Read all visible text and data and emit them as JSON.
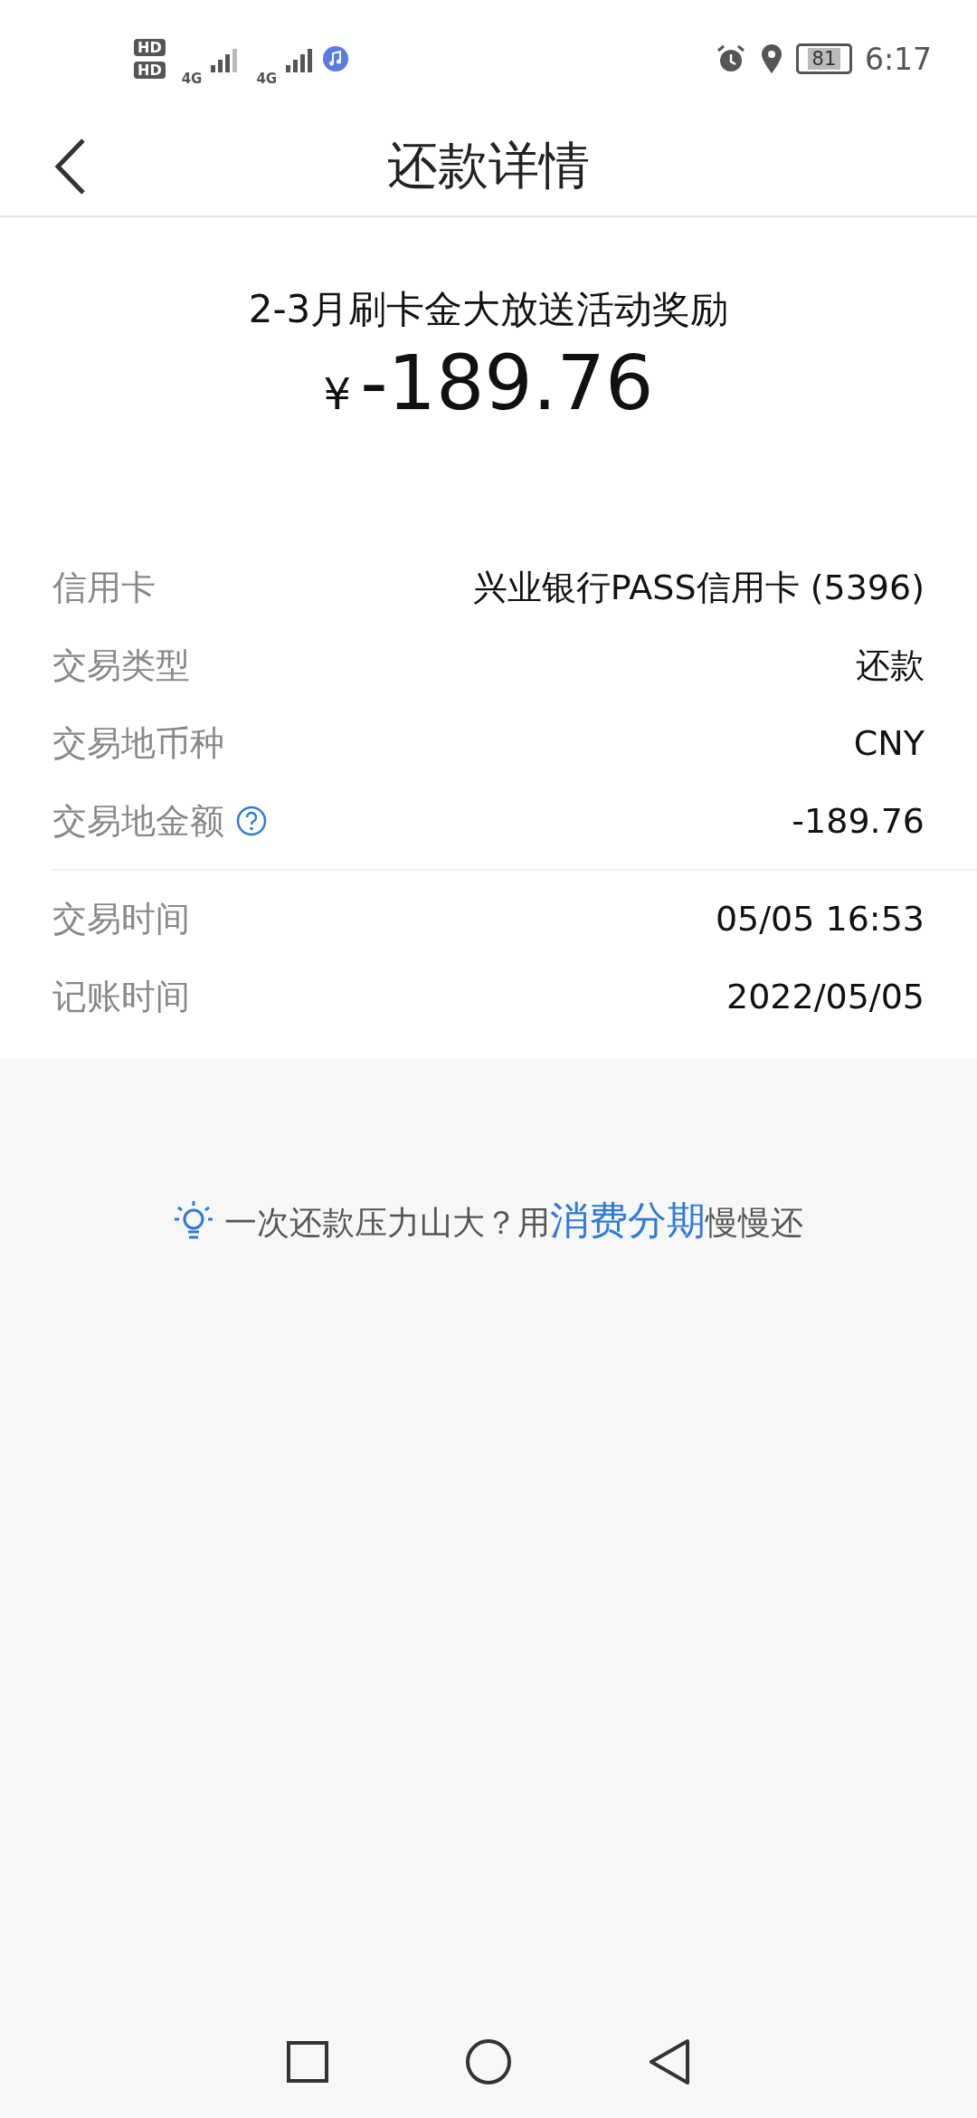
{
  "status_bar": {
    "sim_labels": [
      "HD",
      "HD"
    ],
    "network": [
      "4G",
      "4G"
    ],
    "battery": "81",
    "time": "6:17"
  },
  "header": {
    "title": "还款详情"
  },
  "summary": {
    "title": "2-3月刷卡金大放送活动奖励",
    "currency": "¥",
    "amount": "-189.76"
  },
  "detail_groups": [
    {
      "rows": [
        {
          "label": "信用卡",
          "value": "兴业银行PASS信用卡 (5396)",
          "help": false
        },
        {
          "label": "交易类型",
          "value": "还款",
          "help": false
        },
        {
          "label": "交易地币种",
          "value": "CNY",
          "help": false
        },
        {
          "label": "交易地金额",
          "value": "-189.76",
          "help": true
        }
      ]
    },
    {
      "rows": [
        {
          "label": "交易时间",
          "value": "05/05 16:53",
          "help": false
        },
        {
          "label": "记账时间",
          "value": "2022/05/05",
          "help": false
        }
      ]
    }
  ],
  "tip": {
    "prefix": "一次还款压力山大？用",
    "link": "消费分期",
    "suffix": "慢慢还"
  }
}
